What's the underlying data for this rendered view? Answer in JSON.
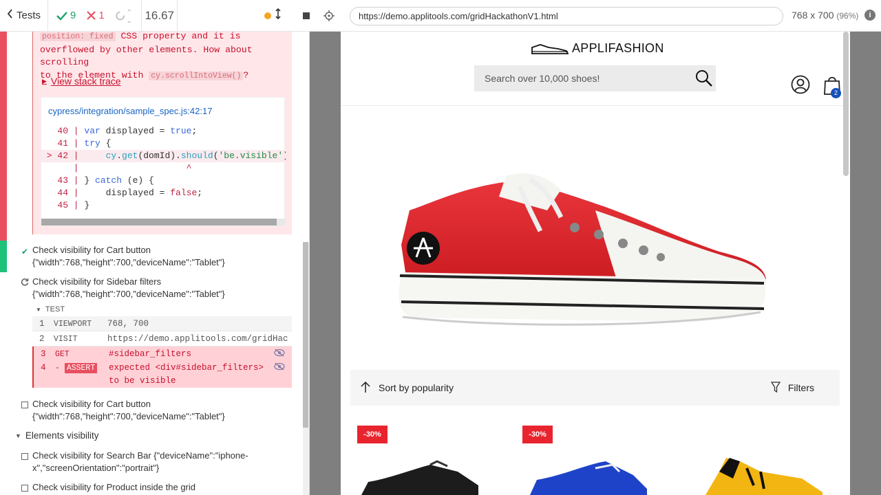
{
  "reporter": {
    "tests_label": "Tests",
    "passed": "9",
    "failed": "1",
    "pending": "--",
    "duration": "16.67",
    "error": {
      "line1_code": "position: fixed",
      "line1_rest": " CSS property and it is",
      "line2": "overflowed by other elements. How about scrolling",
      "line3_a": "to the element with ",
      "line3_code": "cy.scrollIntoView()",
      "line3_b": "?",
      "stack_link": "View stack trace",
      "code_file": "cypress/integration/sample_spec.js:42:17"
    },
    "tests": [
      {
        "title": "Check visibility for Cart button",
        "sub": "{\"width\":768,\"height\":700,\"deviceName\":\"Tablet\"}",
        "state": "passed"
      },
      {
        "title": "Check visibility for Sidebar filters",
        "sub": "{\"width\":768,\"height\":700,\"deviceName\":\"Tablet\"}",
        "state": "running"
      },
      {
        "title": "Check visibility for Cart button",
        "sub": "{\"width\":768,\"height\":700,\"deviceName\":\"Tablet\"}",
        "state": "pending"
      },
      {
        "title": "Check visibility for Search Bar {\"deviceName\":\"iphone-",
        "sub": "x\",\"screenOrientation\":\"portrait\"}",
        "state": "pending"
      },
      {
        "title": "Check visibility for Product inside the grid",
        "sub": "",
        "state": "pending"
      }
    ],
    "test_header": "TEST",
    "commands": [
      {
        "num": "1",
        "name": "VIEWPORT",
        "msg": "768, 700"
      },
      {
        "num": "2",
        "name": "VISIT",
        "msg": "https://demo.applitools.com/gridHac…"
      },
      {
        "num": "3",
        "name": "GET",
        "msg": "#sidebar_filters"
      },
      {
        "num": "4",
        "name": "ASSERT",
        "prefix": "-",
        "msg1": "expected  <div#sidebar_filters>",
        "msg2": "to be  visible"
      }
    ],
    "suite2": "Elements visibility"
  },
  "browser": {
    "url": "https://demo.applitools.com/gridHackathonV1.html",
    "viewport": "768 x 700",
    "scale": "(96%)"
  },
  "app": {
    "brand": "APPLIFASHION",
    "search_placeholder": "Search over 10,000 shoes!",
    "cart_count": "2",
    "sort_label": "Sort by popularity",
    "filters_label": "Filters",
    "discount1": "-30%",
    "discount2": "-30%"
  },
  "colors": {
    "pass": "#1aa16b",
    "fail": "#e94f5f",
    "link": "#1864c5",
    "badge": "#e8252e"
  }
}
